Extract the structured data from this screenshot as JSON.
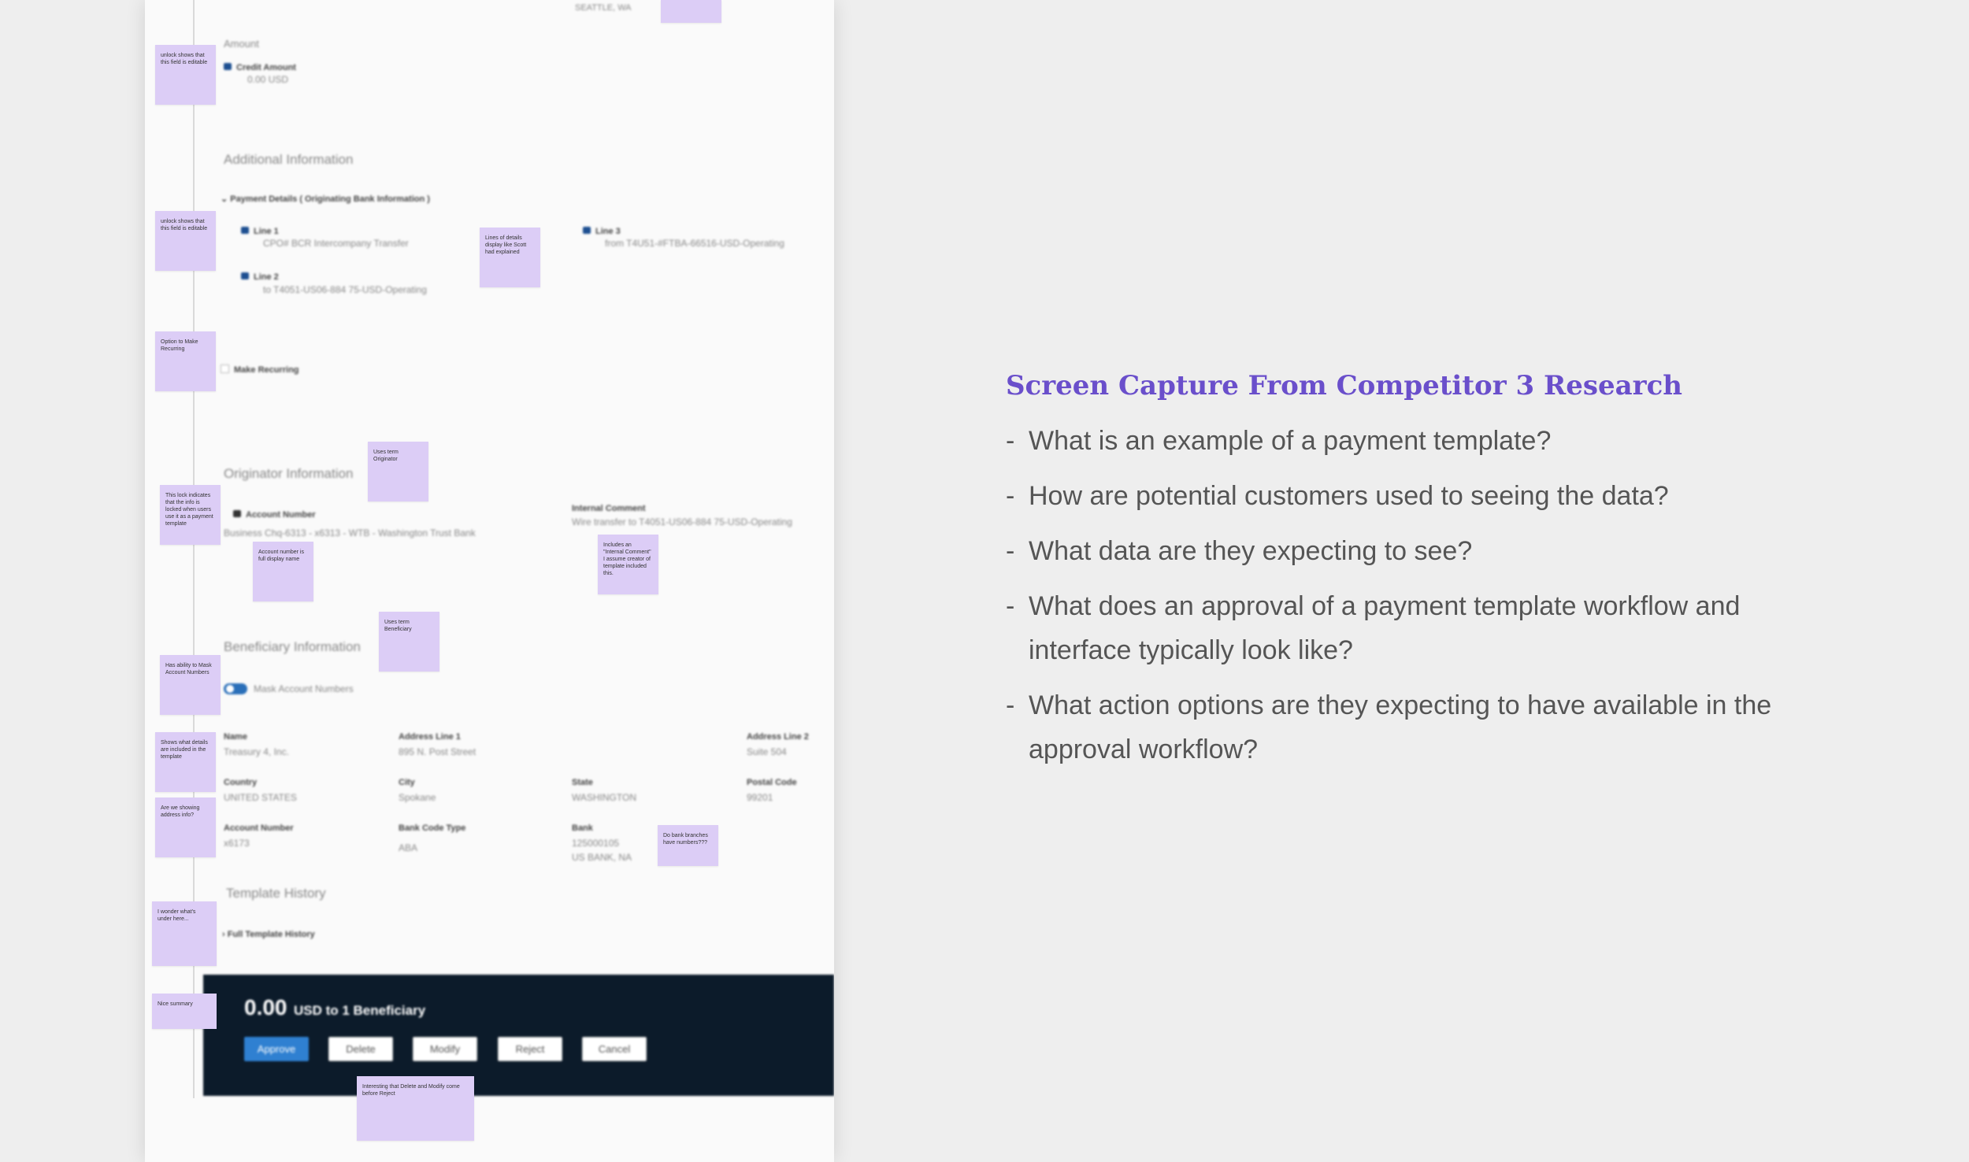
{
  "panel": {
    "top_text": "SEATTLE, WA",
    "amount": {
      "section_label": "Amount",
      "field_label": "Credit Amount",
      "field_value": "0.00 USD"
    },
    "additional_info": {
      "section_label": "Additional Information",
      "payment_details_label": "Payment Details ( Originating Bank Information )",
      "line1_label": "Line 1",
      "line1_value": "CPO# BCR Intercompany Transfer",
      "line2_label": "Line 2",
      "line2_value": "to T4051-US06-884 75-USD-Operating",
      "line3_label": "Line 3",
      "line3_value": "from T4U51-#FTBA-66516-USD-Operating"
    },
    "make_recurring": "Make Recurring",
    "originator": {
      "section_label": "Originator Information",
      "account_label": "Account Number",
      "account_value": "Business Chq-6313 - x6313 - WTB - Washington Trust Bank",
      "internal_comment_label": "Internal Comment",
      "internal_comment_value": "Wire transfer to T4051-US06-884 75-USD-Operating"
    },
    "beneficiary": {
      "section_label": "Beneficiary Information",
      "mask_label": "Mask Account Numbers",
      "fields": [
        {
          "label": "Name",
          "value": "Treasury 4, Inc."
        },
        {
          "label": "Address Line 1",
          "value": "895 N. Post Street"
        },
        {
          "label": "Address Line 2",
          "value": "Suite 504"
        },
        {
          "label": "Country",
          "value": "UNITED STATES"
        },
        {
          "label": "City",
          "value": "Spokane"
        },
        {
          "label": "State",
          "value": "WASHINGTON"
        },
        {
          "label": "Postal Code",
          "value": "99201"
        },
        {
          "label": "Account Number",
          "value": "x6173"
        },
        {
          "label": "Bank Code Type",
          "value": "ABA"
        },
        {
          "label": "Bank",
          "value": "125000105"
        },
        {
          "label": "Bank line 2",
          "value": "US BANK, NA"
        }
      ]
    },
    "template_history": {
      "section_label": "Template History",
      "full_history_label": "Full Template History"
    },
    "footer": {
      "amount": "0.00",
      "summary": "USD to 1 Beneficiary",
      "buttons": [
        "Approve",
        "Delete",
        "Modify",
        "Reject",
        "Cancel"
      ]
    }
  },
  "stickies": [
    "unlock shows that this field is editable",
    "unlock shows that this field is editable",
    "Lines of details display like Scott had explained",
    "Option to Make Recurring",
    "Uses term Originator",
    "This lock indicates that the info is locked when users use it as a payment template",
    "Account number is full display name",
    "Includes an \"Internal Comment\" I assume creator of template included this.",
    "Uses term Beneficiary",
    "Has ability to Mask Account Numbers",
    "Shows what details are included in the template",
    "Are we showing address info?",
    "Do bank branches have numbers???",
    "I wonder what's under here...",
    "Nice summary",
    "Interesting that Delete and Modify come before Reject"
  ],
  "notes": {
    "title": "Screen Capture From Competitor 3 Research",
    "questions": [
      "What is an example of a payment template?",
      "How are potential customers used to seeing the data?",
      "What data are they expecting to see?",
      "What does an approval of a payment template workflow and interface typically look like?",
      "What action options are they expecting to have available in the approval workflow?"
    ],
    "title_color": "#6a4fcb",
    "sticky_color": "#dccdf6",
    "footer_color": "#0c1b2a",
    "primary_button_color": "#2f80d1"
  }
}
